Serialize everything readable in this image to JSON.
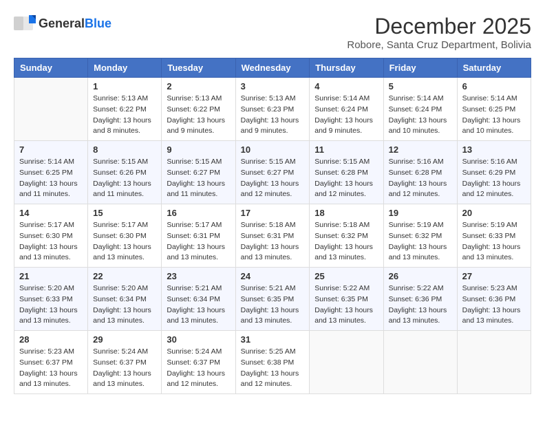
{
  "logo": {
    "general": "General",
    "blue": "Blue"
  },
  "title": {
    "month": "December 2025",
    "location": "Robore, Santa Cruz Department, Bolivia"
  },
  "headers": [
    "Sunday",
    "Monday",
    "Tuesday",
    "Wednesday",
    "Thursday",
    "Friday",
    "Saturday"
  ],
  "weeks": [
    [
      {
        "day": "",
        "sunrise": "",
        "sunset": "",
        "daylight": ""
      },
      {
        "day": "1",
        "sunrise": "Sunrise: 5:13 AM",
        "sunset": "Sunset: 6:22 PM",
        "daylight": "Daylight: 13 hours and 8 minutes."
      },
      {
        "day": "2",
        "sunrise": "Sunrise: 5:13 AM",
        "sunset": "Sunset: 6:22 PM",
        "daylight": "Daylight: 13 hours and 9 minutes."
      },
      {
        "day": "3",
        "sunrise": "Sunrise: 5:13 AM",
        "sunset": "Sunset: 6:23 PM",
        "daylight": "Daylight: 13 hours and 9 minutes."
      },
      {
        "day": "4",
        "sunrise": "Sunrise: 5:14 AM",
        "sunset": "Sunset: 6:24 PM",
        "daylight": "Daylight: 13 hours and 9 minutes."
      },
      {
        "day": "5",
        "sunrise": "Sunrise: 5:14 AM",
        "sunset": "Sunset: 6:24 PM",
        "daylight": "Daylight: 13 hours and 10 minutes."
      },
      {
        "day": "6",
        "sunrise": "Sunrise: 5:14 AM",
        "sunset": "Sunset: 6:25 PM",
        "daylight": "Daylight: 13 hours and 10 minutes."
      }
    ],
    [
      {
        "day": "7",
        "sunrise": "Sunrise: 5:14 AM",
        "sunset": "Sunset: 6:25 PM",
        "daylight": "Daylight: 13 hours and 11 minutes."
      },
      {
        "day": "8",
        "sunrise": "Sunrise: 5:15 AM",
        "sunset": "Sunset: 6:26 PM",
        "daylight": "Daylight: 13 hours and 11 minutes."
      },
      {
        "day": "9",
        "sunrise": "Sunrise: 5:15 AM",
        "sunset": "Sunset: 6:27 PM",
        "daylight": "Daylight: 13 hours and 11 minutes."
      },
      {
        "day": "10",
        "sunrise": "Sunrise: 5:15 AM",
        "sunset": "Sunset: 6:27 PM",
        "daylight": "Daylight: 13 hours and 12 minutes."
      },
      {
        "day": "11",
        "sunrise": "Sunrise: 5:15 AM",
        "sunset": "Sunset: 6:28 PM",
        "daylight": "Daylight: 13 hours and 12 minutes."
      },
      {
        "day": "12",
        "sunrise": "Sunrise: 5:16 AM",
        "sunset": "Sunset: 6:28 PM",
        "daylight": "Daylight: 13 hours and 12 minutes."
      },
      {
        "day": "13",
        "sunrise": "Sunrise: 5:16 AM",
        "sunset": "Sunset: 6:29 PM",
        "daylight": "Daylight: 13 hours and 12 minutes."
      }
    ],
    [
      {
        "day": "14",
        "sunrise": "Sunrise: 5:17 AM",
        "sunset": "Sunset: 6:30 PM",
        "daylight": "Daylight: 13 hours and 13 minutes."
      },
      {
        "day": "15",
        "sunrise": "Sunrise: 5:17 AM",
        "sunset": "Sunset: 6:30 PM",
        "daylight": "Daylight: 13 hours and 13 minutes."
      },
      {
        "day": "16",
        "sunrise": "Sunrise: 5:17 AM",
        "sunset": "Sunset: 6:31 PM",
        "daylight": "Daylight: 13 hours and 13 minutes."
      },
      {
        "day": "17",
        "sunrise": "Sunrise: 5:18 AM",
        "sunset": "Sunset: 6:31 PM",
        "daylight": "Daylight: 13 hours and 13 minutes."
      },
      {
        "day": "18",
        "sunrise": "Sunrise: 5:18 AM",
        "sunset": "Sunset: 6:32 PM",
        "daylight": "Daylight: 13 hours and 13 minutes."
      },
      {
        "day": "19",
        "sunrise": "Sunrise: 5:19 AM",
        "sunset": "Sunset: 6:32 PM",
        "daylight": "Daylight: 13 hours and 13 minutes."
      },
      {
        "day": "20",
        "sunrise": "Sunrise: 5:19 AM",
        "sunset": "Sunset: 6:33 PM",
        "daylight": "Daylight: 13 hours and 13 minutes."
      }
    ],
    [
      {
        "day": "21",
        "sunrise": "Sunrise: 5:20 AM",
        "sunset": "Sunset: 6:33 PM",
        "daylight": "Daylight: 13 hours and 13 minutes."
      },
      {
        "day": "22",
        "sunrise": "Sunrise: 5:20 AM",
        "sunset": "Sunset: 6:34 PM",
        "daylight": "Daylight: 13 hours and 13 minutes."
      },
      {
        "day": "23",
        "sunrise": "Sunrise: 5:21 AM",
        "sunset": "Sunset: 6:34 PM",
        "daylight": "Daylight: 13 hours and 13 minutes."
      },
      {
        "day": "24",
        "sunrise": "Sunrise: 5:21 AM",
        "sunset": "Sunset: 6:35 PM",
        "daylight": "Daylight: 13 hours and 13 minutes."
      },
      {
        "day": "25",
        "sunrise": "Sunrise: 5:22 AM",
        "sunset": "Sunset: 6:35 PM",
        "daylight": "Daylight: 13 hours and 13 minutes."
      },
      {
        "day": "26",
        "sunrise": "Sunrise: 5:22 AM",
        "sunset": "Sunset: 6:36 PM",
        "daylight": "Daylight: 13 hours and 13 minutes."
      },
      {
        "day": "27",
        "sunrise": "Sunrise: 5:23 AM",
        "sunset": "Sunset: 6:36 PM",
        "daylight": "Daylight: 13 hours and 13 minutes."
      }
    ],
    [
      {
        "day": "28",
        "sunrise": "Sunrise: 5:23 AM",
        "sunset": "Sunset: 6:37 PM",
        "daylight": "Daylight: 13 hours and 13 minutes."
      },
      {
        "day": "29",
        "sunrise": "Sunrise: 5:24 AM",
        "sunset": "Sunset: 6:37 PM",
        "daylight": "Daylight: 13 hours and 13 minutes."
      },
      {
        "day": "30",
        "sunrise": "Sunrise: 5:24 AM",
        "sunset": "Sunset: 6:37 PM",
        "daylight": "Daylight: 13 hours and 12 minutes."
      },
      {
        "day": "31",
        "sunrise": "Sunrise: 5:25 AM",
        "sunset": "Sunset: 6:38 PM",
        "daylight": "Daylight: 13 hours and 12 minutes."
      },
      {
        "day": "",
        "sunrise": "",
        "sunset": "",
        "daylight": ""
      },
      {
        "day": "",
        "sunrise": "",
        "sunset": "",
        "daylight": ""
      },
      {
        "day": "",
        "sunrise": "",
        "sunset": "",
        "daylight": ""
      }
    ]
  ]
}
